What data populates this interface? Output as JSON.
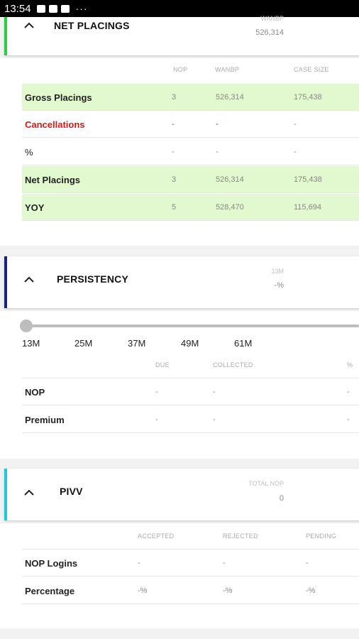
{
  "status_bar": {
    "time": "13:54",
    "more": "···"
  },
  "net_placings": {
    "title": "NET PLACINGS",
    "metric_label": "WANBP",
    "metric_value": "526,314",
    "accent": "#2ecc40",
    "columns": [
      "NOP",
      "WANBP",
      "CASE SIZE"
    ],
    "rows": [
      {
        "label": "Gross Placings",
        "nop": "3",
        "wanbp": "526,314",
        "case": "175,438",
        "highlight": true
      },
      {
        "label": "Cancellations",
        "nop": "-",
        "wanbp": "-",
        "case": "-",
        "highlight": false
      },
      {
        "label": "%",
        "nop": "-",
        "wanbp": "-",
        "case": "-",
        "highlight": false
      },
      {
        "label": "Net Placings",
        "nop": "3",
        "wanbp": "526,314",
        "case": "175,438",
        "highlight": true
      },
      {
        "label": "YOY",
        "nop": "5",
        "wanbp": "528,470",
        "case": "115,694",
        "highlight": true
      }
    ]
  },
  "persistency": {
    "title": "PERSISTENCY",
    "metric_label": "13M",
    "metric_value": "-%",
    "accent": "#1a237e",
    "slider_level": 0,
    "ticks": [
      "13M",
      "25M",
      "37M",
      "49M",
      "61M"
    ],
    "columns": [
      "DUE",
      "COLLECTED",
      "%"
    ],
    "rows": [
      {
        "label": "NOP",
        "due": "-",
        "collected": "-",
        "pct": "-"
      },
      {
        "label": "Premium",
        "due": "-",
        "collected": "-",
        "pct": "-"
      }
    ]
  },
  "pivv": {
    "title": "PIVV",
    "metric_label": "TOTAL NOP",
    "metric_value": "0",
    "accent": "#26c6da",
    "columns": [
      "ACCEPTED",
      "REJECTED",
      "PENDING"
    ],
    "rows": [
      {
        "label": "NOP Logins",
        "accepted": "-",
        "rejected": "-",
        "pending": "-"
      },
      {
        "label": "Percentage",
        "accepted": "-%",
        "rejected": "-%",
        "pending": "-%"
      }
    ]
  }
}
